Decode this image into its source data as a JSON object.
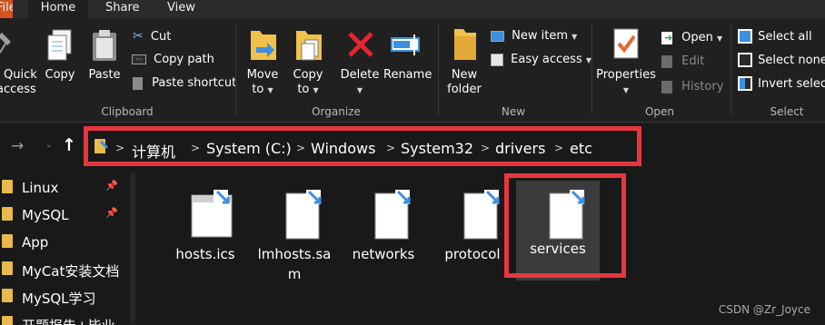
{
  "tabs": {
    "file": "File",
    "home": "Home",
    "share": "Share",
    "view": "View"
  },
  "ribbon": {
    "clipboard": {
      "quick_access_line1": "Quick",
      "quick_access_line2": "access",
      "copy": "Copy",
      "paste": "Paste",
      "cut": "Cut",
      "copy_path": "Copy path",
      "paste_shortcut": "Paste shortcut",
      "label": "Clipboard"
    },
    "organize": {
      "move_to_line1": "Move",
      "move_to_line2": "to",
      "copy_to_line1": "Copy",
      "copy_to_line2": "to",
      "delete": "Delete",
      "rename": "Rename",
      "label": "Organize"
    },
    "new": {
      "new_folder_line1": "New",
      "new_folder_line2": "folder",
      "new_item": "New item",
      "easy_access": "Easy access",
      "label": "New"
    },
    "open": {
      "properties": "Properties",
      "open": "Open",
      "edit": "Edit",
      "history": "History",
      "label": "Open"
    },
    "select": {
      "select_all": "Select all",
      "select_none": "Select none",
      "invert_selection": "Invert selection",
      "label": "Select"
    }
  },
  "address": {
    "crumbs": [
      "计算机",
      "System (C:)",
      "Windows",
      "System32",
      "drivers",
      "etc"
    ]
  },
  "nav": {
    "items": [
      {
        "label": "Linux",
        "pinned": true
      },
      {
        "label": "MySQL",
        "pinned": true
      },
      {
        "label": "App",
        "pinned": false
      },
      {
        "label": "MyCat安装文档",
        "pinned": false
      },
      {
        "label": "MySQL学习",
        "pinned": false
      },
      {
        "label": "开题报告+毕业",
        "pinned": false
      }
    ]
  },
  "files": [
    {
      "name": "hosts.ics",
      "type": "window-file"
    },
    {
      "name": "lmhosts.sam",
      "type": "generic-file"
    },
    {
      "name": "networks",
      "type": "generic-file"
    },
    {
      "name": "protocol",
      "type": "generic-file"
    },
    {
      "name": "services",
      "type": "generic-file",
      "selected": true
    }
  ],
  "watermark": "CSDN @Zr_Joyce",
  "colors": {
    "accent_red": "#e8363f",
    "folder_yellow": "#e9b94b",
    "background": "#191919",
    "ribbon": "#202020"
  }
}
